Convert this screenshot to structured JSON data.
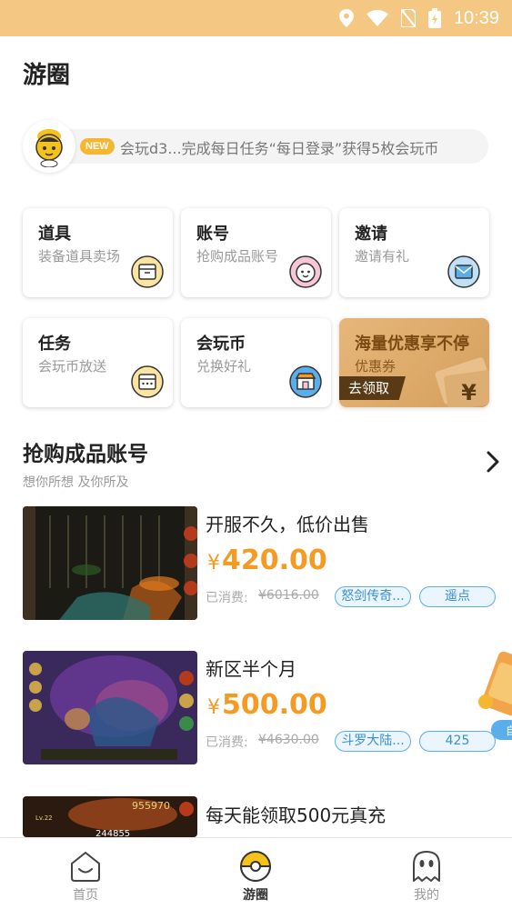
{
  "status_bar": {
    "time": "10:39"
  },
  "page_title": "游圈",
  "notice": {
    "badge": "NEW",
    "text": "会玩d3...完成每日任务“每日登录”获得5枚会玩币"
  },
  "cards": [
    {
      "title": "道具",
      "subtitle": "装备道具卖场",
      "icon": "box-icon"
    },
    {
      "title": "账号",
      "subtitle": "抢购成品账号",
      "icon": "face-icon"
    },
    {
      "title": "邀请",
      "subtitle": "邀请有礼",
      "icon": "envelope-icon"
    },
    {
      "title": "任务",
      "subtitle": "会玩币放送",
      "icon": "calendar-icon"
    },
    {
      "title": "会玩币",
      "subtitle": "兑换好礼",
      "icon": "shop-icon"
    }
  ],
  "promo": {
    "title": "海量优惠享不停",
    "subtitle": "优惠券",
    "button": "去领取",
    "mark": "¥"
  },
  "section": {
    "title": "抢购成品账号",
    "subtitle": "想你所想  及你所及"
  },
  "items": [
    {
      "title": "开服不久，低价出售",
      "yen": "¥",
      "price": "420.00",
      "spent_label": "已消费:",
      "spent_value": "¥6016.00",
      "game_tag": "怒剑传奇...",
      "server_tag": "遥点"
    },
    {
      "title": "新区半个月",
      "yen": "¥",
      "price": "500.00",
      "spent_label": "已消费:",
      "spent_value": "¥4630.00",
      "game_tag": "斗罗大陆...",
      "server_tag": "425"
    },
    {
      "title": "每天能领取500元真充"
    }
  ],
  "thumb_texts": {
    "t3_score": "955970",
    "t3_level": "Lv.22",
    "t3_hp": "244855"
  },
  "float_widget": {
    "label": "自"
  },
  "tabbar": {
    "tabs": [
      {
        "label": "首页",
        "icon": "home-smile-icon",
        "active": false
      },
      {
        "label": "游圈",
        "icon": "ball-icon",
        "active": true
      },
      {
        "label": "我的",
        "icon": "ghost-icon",
        "active": false
      }
    ]
  },
  "colors": {
    "status_bar": "#f4c882",
    "accent": "#f5b731",
    "price": "#f59a23",
    "tag_border": "#5aaee9"
  }
}
